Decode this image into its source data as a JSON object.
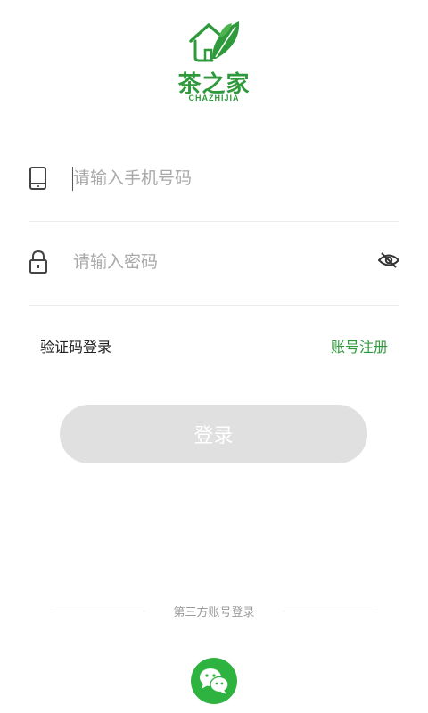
{
  "brand": {
    "title": "茶之家",
    "subtitle": "CHAZHIJIA",
    "color": "#2f9a3c"
  },
  "phone": {
    "icon": "phone-icon",
    "placeholder": "请输入手机号码",
    "value": ""
  },
  "password": {
    "icon": "lock-icon",
    "placeholder": "请输入密码",
    "value": "",
    "toggle_icon": "eye-off-icon"
  },
  "links": {
    "sms_login": "验证码登录",
    "register": "账号注册"
  },
  "login_button": {
    "label": "登录",
    "background": "#e0e0e0"
  },
  "third_party": {
    "label": "第三方账号登录",
    "wechat_icon": "wechat-icon",
    "wechat_color": "#2fb340"
  }
}
